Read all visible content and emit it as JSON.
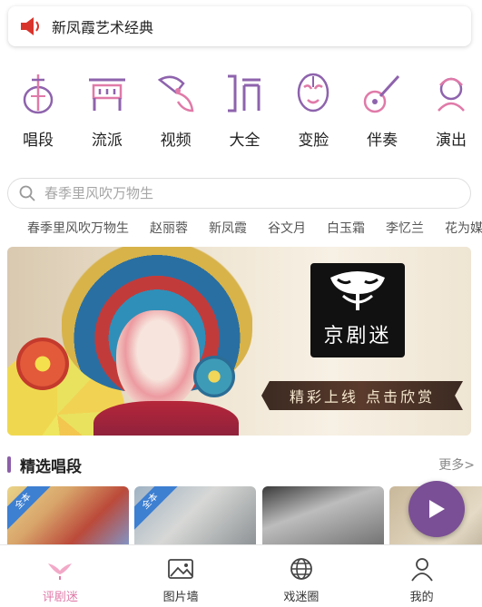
{
  "notice": {
    "text": "新凤霞艺术经典",
    "icon": "speaker-icon",
    "icon_color": "#d9342b"
  },
  "categories": [
    {
      "label": "唱段",
      "icon": "pipa-icon"
    },
    {
      "label": "流派",
      "icon": "gate-icon"
    },
    {
      "label": "视频",
      "icon": "fan-icon"
    },
    {
      "label": "大全",
      "icon": "book-icon"
    },
    {
      "label": "变脸",
      "icon": "mask-icon"
    },
    {
      "label": "伴奏",
      "icon": "ruan-icon"
    },
    {
      "label": "演出",
      "icon": "performer-icon"
    }
  ],
  "search": {
    "placeholder": "春季里风吹万物生"
  },
  "tags": [
    "春季里风吹万物生",
    "赵丽蓉",
    "新凤霞",
    "谷文月",
    "白玉霜",
    "李忆兰",
    "花为媒"
  ],
  "banner": {
    "logo_text": "京剧迷",
    "ribbon_text": "精彩上线  点击欣赏"
  },
  "section": {
    "title": "精选唱段",
    "more": "更多>"
  },
  "thumbs": [
    {
      "badge": "全本"
    },
    {
      "badge": "全本"
    },
    {
      "badge": ""
    },
    {
      "badge": ""
    }
  ],
  "tabbar": {
    "active_color": "#e07aa8",
    "items": [
      {
        "label": "评剧迷",
        "icon": "wings-icon"
      },
      {
        "label": "图片墙",
        "icon": "image-icon"
      },
      {
        "label": "戏迷圈",
        "icon": "globe-icon"
      },
      {
        "label": "我的",
        "icon": "user-icon"
      }
    ]
  },
  "colors": {
    "accent": "#8b5ea8",
    "icon_purple": "#8e63ad",
    "icon_pink": "#e07aa8"
  }
}
